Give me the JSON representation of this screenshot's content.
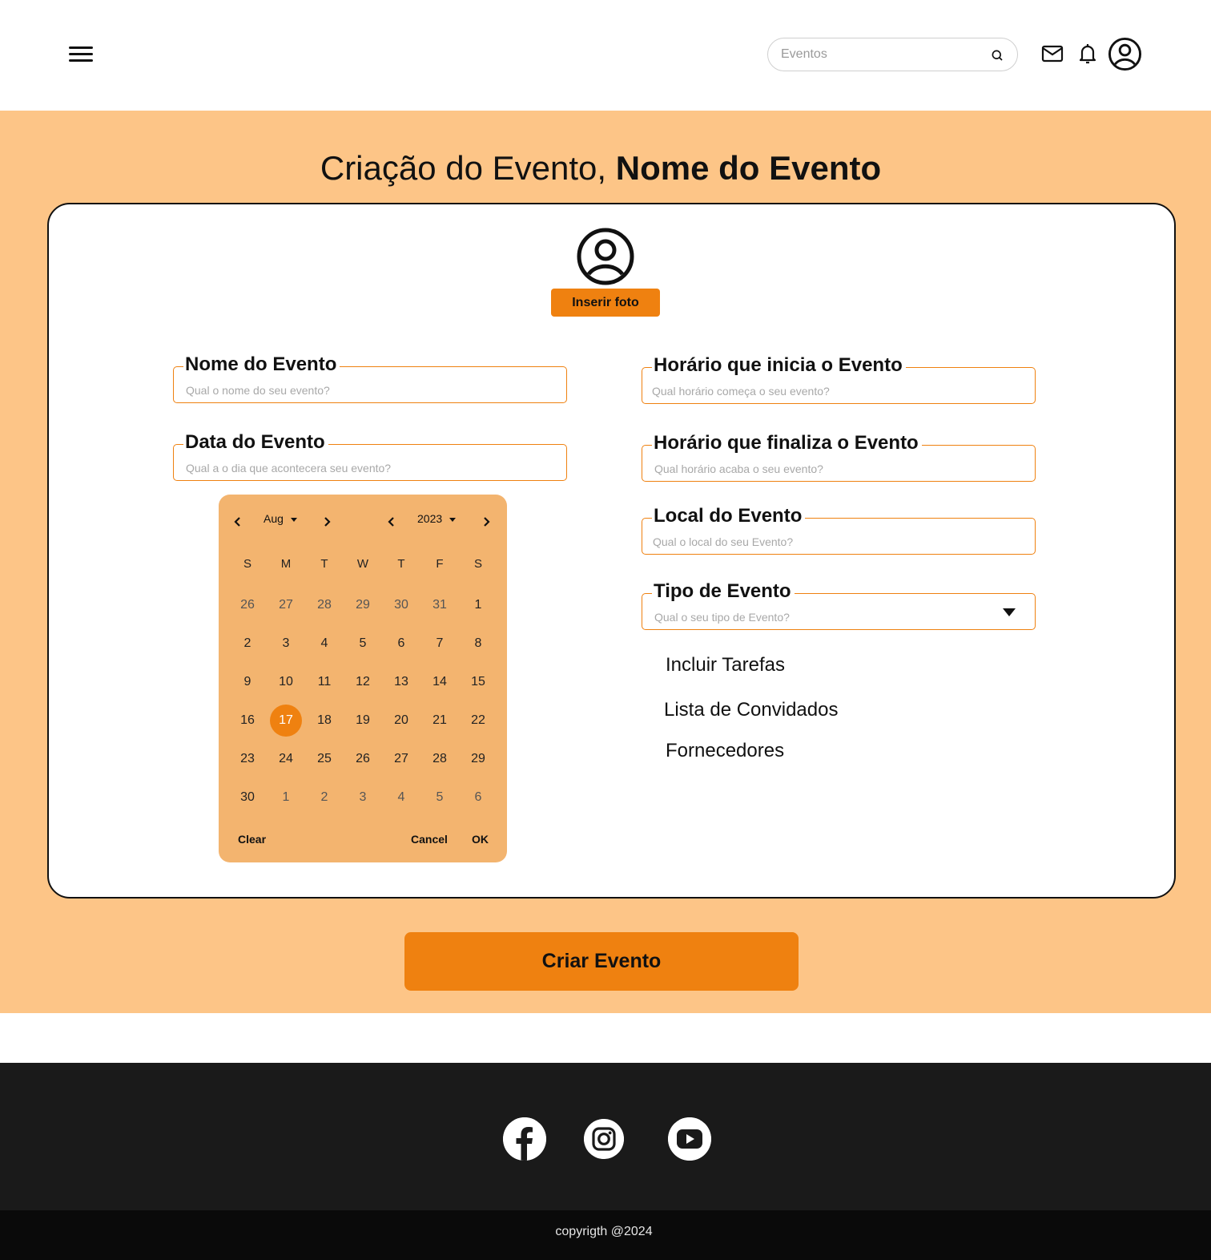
{
  "header": {
    "search_placeholder": "Eventos"
  },
  "page": {
    "title_prefix": "Criação do Evento,",
    "title_name": "Nome do Evento",
    "photo_button": "Inserir foto",
    "create_button": "Criar Evento"
  },
  "fields": {
    "nome": {
      "label": "Nome do Evento",
      "placeholder": "Qual o nome do seu evento?"
    },
    "data": {
      "label": "Data do Evento",
      "placeholder": "Qual a o dia que acontecera seu evento?"
    },
    "inicio": {
      "label": "Horário que inicia o Evento",
      "placeholder": "Qual horário começa o seu evento?"
    },
    "fim": {
      "label": "Horário que finaliza o Evento",
      "placeholder": "Qual horário acaba o seu evento?"
    },
    "local": {
      "label": "Local do Evento",
      "placeholder": "Qual o local do seu Evento?"
    },
    "tipo": {
      "label": "Tipo de Evento",
      "placeholder": "Qual o seu tipo de Evento?"
    }
  },
  "options": {
    "tarefas": "Incluir Tarefas",
    "convidados": "Lista de Convidados",
    "fornecedores": "Fornecedores"
  },
  "calendar": {
    "month": "Aug",
    "year": "2023",
    "weekdays": [
      "S",
      "M",
      "T",
      "W",
      "T",
      "F",
      "S"
    ],
    "weeks": [
      [
        "26",
        "27",
        "28",
        "29",
        "30",
        "31",
        "1"
      ],
      [
        "2",
        "3",
        "4",
        "5",
        "6",
        "7",
        "8"
      ],
      [
        "9",
        "10",
        "11",
        "12",
        "13",
        "14",
        "15"
      ],
      [
        "16",
        "17",
        "18",
        "19",
        "20",
        "21",
        "22"
      ],
      [
        "23",
        "24",
        "25",
        "26",
        "27",
        "28",
        "29"
      ],
      [
        "30",
        "1",
        "2",
        "3",
        "4",
        "5",
        "6"
      ]
    ],
    "selected_day": "17",
    "clear_label": "Clear",
    "cancel_label": "Cancel",
    "ok_label": "OK"
  },
  "colors": {
    "accent": "#ef8110",
    "section_bg": "#fdc587",
    "calendar_bg": "#f3b46f",
    "footer_bg": "#1a1a1a"
  },
  "footer": {
    "social": [
      "facebook-icon",
      "instagram-icon",
      "youtube-icon"
    ],
    "copyright": "copyrigth @2024"
  }
}
